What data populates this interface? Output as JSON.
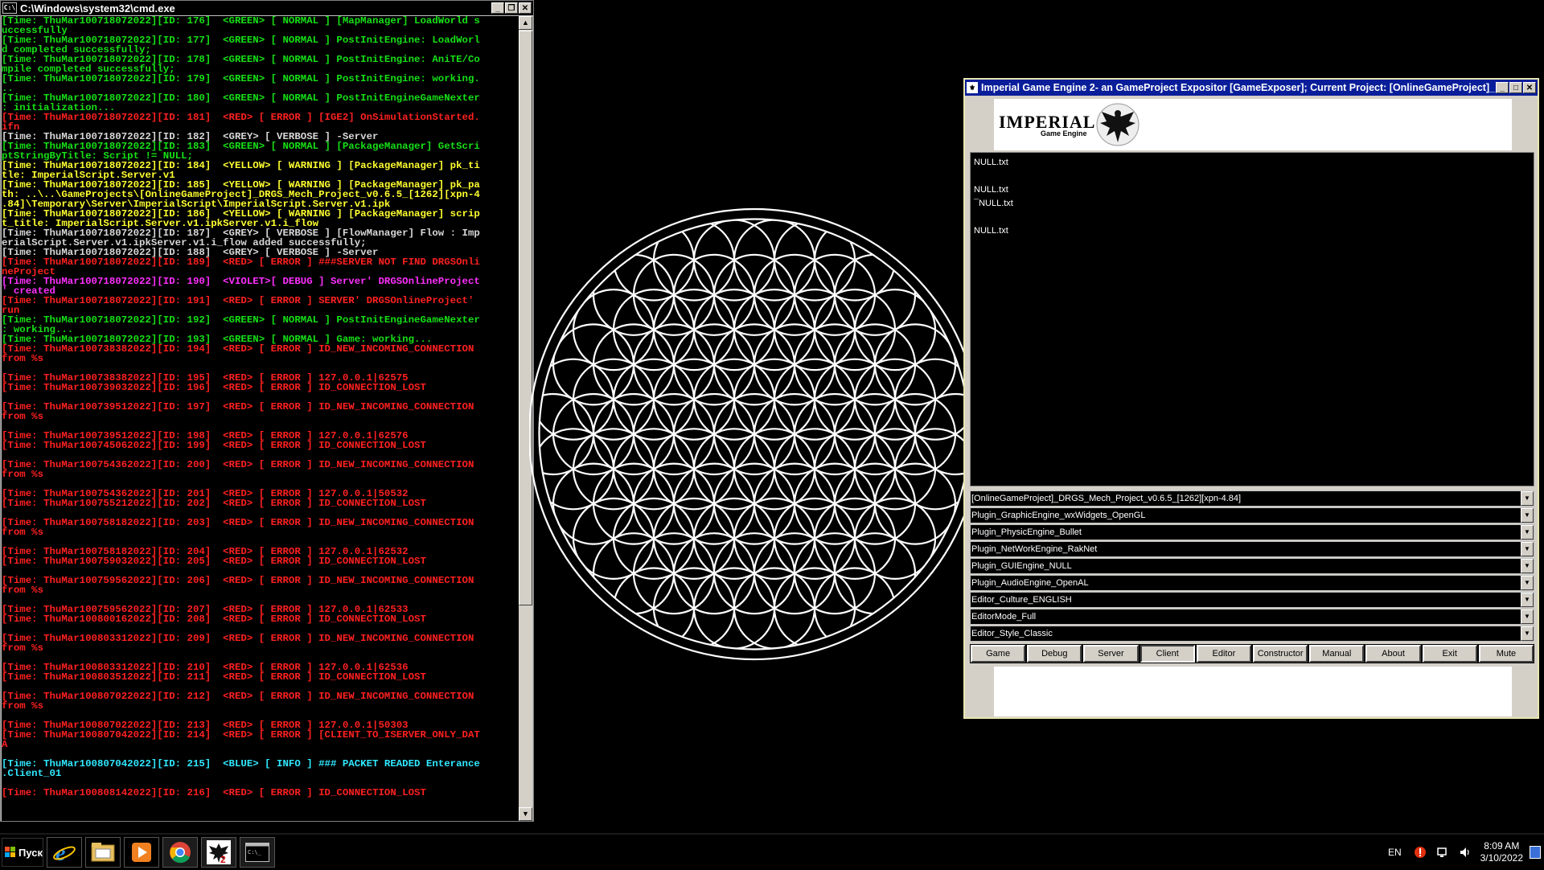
{
  "cmd": {
    "title": "C:\\Windows\\system32\\cmd.exe",
    "lines": [
      {
        "t": "[Time: ThuMar100718072022][ID: 176]  <GREEN> [ NORMAL ] [MapManager] LoadWorld s",
        "c": "green"
      },
      {
        "t": "uccessfully",
        "c": "green"
      },
      {
        "t": "[Time: ThuMar100718072022][ID: 177]  <GREEN> [ NORMAL ] PostInitEngine: LoadWorl",
        "c": "green"
      },
      {
        "t": "d completed successfully;",
        "c": "green"
      },
      {
        "t": "[Time: ThuMar100718072022][ID: 178]  <GREEN> [ NORMAL ] PostInitEngine: AniTE/Co",
        "c": "green"
      },
      {
        "t": "mpile completed successfully;",
        "c": "green"
      },
      {
        "t": "[Time: ThuMar100718072022][ID: 179]  <GREEN> [ NORMAL ] PostInitEngine: working.",
        "c": "green"
      },
      {
        "t": "..",
        "c": "green"
      },
      {
        "t": "[Time: ThuMar100718072022][ID: 180]  <GREEN> [ NORMAL ] PostInitEngineGameNexter",
        "c": "green"
      },
      {
        "t": ": initialization...",
        "c": "green"
      },
      {
        "t": "[Time: ThuMar100718072022][ID: 181]  <RED> [ ERROR ] [IGE2] OnSimulationStarted.",
        "c": "red"
      },
      {
        "t": "ifn",
        "c": "red"
      },
      {
        "t": "[Time: ThuMar100718072022][ID: 182]  <GREY> [ VERBOSE ] -Server",
        "c": "grey"
      },
      {
        "t": "[Time: ThuMar100718072022][ID: 183]  <GREEN> [ NORMAL ] [PackageManager] GetScri",
        "c": "green"
      },
      {
        "t": "ptStringByTitle: Script != NULL;",
        "c": "green"
      },
      {
        "t": "[Time: ThuMar100718072022][ID: 184]  <YELLOW> [ WARNING ] [PackageManager] pk_ti",
        "c": "yellow"
      },
      {
        "t": "tle: ImperialScript.Server.v1",
        "c": "yellow"
      },
      {
        "t": "[Time: ThuMar100718072022][ID: 185]  <YELLOW> [ WARNING ] [PackageManager] pk_pa",
        "c": "yellow"
      },
      {
        "t": "th: ..\\..\\GameProjects\\[OnlineGameProject]_DRGS_Mech_Project_v0.6.5_[1262][xpn-4",
        "c": "yellow"
      },
      {
        "t": ".84]\\Temporary\\Server\\ImperialScript\\ImperialScript.Server.v1.ipk",
        "c": "yellow"
      },
      {
        "t": "[Time: ThuMar100718072022][ID: 186]  <YELLOW> [ WARNING ] [PackageManager] scrip",
        "c": "yellow"
      },
      {
        "t": "t_title: ImperialScript.Server.v1.ipkServer.v1.i_flow",
        "c": "yellow"
      },
      {
        "t": "[Time: ThuMar100718072022][ID: 187]  <GREY> [ VERBOSE ] [FlowManager] Flow : Imp",
        "c": "grey"
      },
      {
        "t": "erialScript.Server.v1.ipkServer.v1.i_flow added successfully;",
        "c": "grey"
      },
      {
        "t": "[Time: ThuMar100718072022][ID: 188]  <GREY> [ VERBOSE ] -Server",
        "c": "grey"
      },
      {
        "t": "[Time: ThuMar100718072022][ID: 189]  <RED> [ ERROR ] ###SERVER NOT FIND DRGSOnli",
        "c": "red"
      },
      {
        "t": "neProject",
        "c": "red"
      },
      {
        "t": "[Time: ThuMar100718072022][ID: 190]  <VIOLET>[ DEBUG ] Server' DRGSOnlineProject",
        "c": "violet"
      },
      {
        "t": "' created",
        "c": "violet"
      },
      {
        "t": "[Time: ThuMar100718072022][ID: 191]  <RED> [ ERROR ] SERVER' DRGSOnlineProject'",
        "c": "red"
      },
      {
        "t": "run",
        "c": "red"
      },
      {
        "t": "[Time: ThuMar100718072022][ID: 192]  <GREEN> [ NORMAL ] PostInitEngineGameNexter",
        "c": "green"
      },
      {
        "t": ": working...",
        "c": "green"
      },
      {
        "t": "[Time: ThuMar100718072022][ID: 193]  <GREEN> [ NORMAL ] Game: working...",
        "c": "green"
      },
      {
        "t": "[Time: ThuMar100738382022][ID: 194]  <RED> [ ERROR ] ID_NEW_INCOMING_CONNECTION",
        "c": "red"
      },
      {
        "t": "from %s",
        "c": "red"
      },
      {
        "t": "",
        "c": "red"
      },
      {
        "t": "[Time: ThuMar100738382022][ID: 195]  <RED> [ ERROR ] 127.0.0.1|62575",
        "c": "red"
      },
      {
        "t": "[Time: ThuMar100739032022][ID: 196]  <RED> [ ERROR ] ID_CONNECTION_LOST",
        "c": "red"
      },
      {
        "t": "",
        "c": "red"
      },
      {
        "t": "[Time: ThuMar100739512022][ID: 197]  <RED> [ ERROR ] ID_NEW_INCOMING_CONNECTION",
        "c": "red"
      },
      {
        "t": "from %s",
        "c": "red"
      },
      {
        "t": "",
        "c": "red"
      },
      {
        "t": "[Time: ThuMar100739512022][ID: 198]  <RED> [ ERROR ] 127.0.0.1|62576",
        "c": "red"
      },
      {
        "t": "[Time: ThuMar100745062022][ID: 199]  <RED> [ ERROR ] ID_CONNECTION_LOST",
        "c": "red"
      },
      {
        "t": "",
        "c": "red"
      },
      {
        "t": "[Time: ThuMar100754362022][ID: 200]  <RED> [ ERROR ] ID_NEW_INCOMING_CONNECTION",
        "c": "red"
      },
      {
        "t": "from %s",
        "c": "red"
      },
      {
        "t": "",
        "c": "red"
      },
      {
        "t": "[Time: ThuMar100754362022][ID: 201]  <RED> [ ERROR ] 127.0.0.1|50532",
        "c": "red"
      },
      {
        "t": "[Time: ThuMar100755212022][ID: 202]  <RED> [ ERROR ] ID_CONNECTION_LOST",
        "c": "red"
      },
      {
        "t": "",
        "c": "red"
      },
      {
        "t": "[Time: ThuMar100758182022][ID: 203]  <RED> [ ERROR ] ID_NEW_INCOMING_CONNECTION",
        "c": "red"
      },
      {
        "t": "from %s",
        "c": "red"
      },
      {
        "t": "",
        "c": "red"
      },
      {
        "t": "[Time: ThuMar100758182022][ID: 204]  <RED> [ ERROR ] 127.0.0.1|62532",
        "c": "red"
      },
      {
        "t": "[Time: ThuMar100759032022][ID: 205]  <RED> [ ERROR ] ID_CONNECTION_LOST",
        "c": "red"
      },
      {
        "t": "",
        "c": "red"
      },
      {
        "t": "[Time: ThuMar100759562022][ID: 206]  <RED> [ ERROR ] ID_NEW_INCOMING_CONNECTION",
        "c": "red"
      },
      {
        "t": "from %s",
        "c": "red"
      },
      {
        "t": "",
        "c": "red"
      },
      {
        "t": "[Time: ThuMar100759562022][ID: 207]  <RED> [ ERROR ] 127.0.0.1|62533",
        "c": "red"
      },
      {
        "t": "[Time: ThuMar100800162022][ID: 208]  <RED> [ ERROR ] ID_CONNECTION_LOST",
        "c": "red"
      },
      {
        "t": "",
        "c": "red"
      },
      {
        "t": "[Time: ThuMar100803312022][ID: 209]  <RED> [ ERROR ] ID_NEW_INCOMING_CONNECTION",
        "c": "red"
      },
      {
        "t": "from %s",
        "c": "red"
      },
      {
        "t": "",
        "c": "red"
      },
      {
        "t": "[Time: ThuMar100803312022][ID: 210]  <RED> [ ERROR ] 127.0.0.1|62536",
        "c": "red"
      },
      {
        "t": "[Time: ThuMar100803512022][ID: 211]  <RED> [ ERROR ] ID_CONNECTION_LOST",
        "c": "red"
      },
      {
        "t": "",
        "c": "red"
      },
      {
        "t": "[Time: ThuMar100807022022][ID: 212]  <RED> [ ERROR ] ID_NEW_INCOMING_CONNECTION",
        "c": "red"
      },
      {
        "t": "from %s",
        "c": "red"
      },
      {
        "t": "",
        "c": "red"
      },
      {
        "t": "[Time: ThuMar100807022022][ID: 213]  <RED> [ ERROR ] 127.0.0.1|50303",
        "c": "red"
      },
      {
        "t": "[Time: ThuMar100807042022][ID: 214]  <RED> [ ERROR ] [CLIENT_TO_ISERVER_ONLY_DAT",
        "c": "red"
      },
      {
        "t": "A",
        "c": "red"
      },
      {
        "t": "",
        "c": "red"
      },
      {
        "t": "[Time: ThuMar100807042022][ID: 215]  <BLUE> [ INFO ] ### PACKET READED Enterance",
        "c": "blue"
      },
      {
        "t": ".Client_01",
        "c": "blue"
      },
      {
        "t": "",
        "c": "red"
      },
      {
        "t": "[Time: ThuMar100808142022][ID: 216]  <RED> [ ERROR ] ID_CONNECTION_LOST",
        "c": "red"
      }
    ]
  },
  "engine": {
    "title": "Imperial Game Engine 2- an GameProject Expositor [GameExposer];   Current Project: [OnlineGameProject]_...",
    "logo_text": "IMPERIAL",
    "logo_sub": "Game Engine",
    "files": [
      "NULL.txt",
      "",
      "NULL.txt",
      "¯NULL.txt",
      "",
      "NULL.txt"
    ],
    "combos": [
      "[OnlineGameProject]_DRGS_Mech_Project_v0.6.5_[1262][xpn-4.84]",
      "Plugin_GraphicEngine_wxWidgets_OpenGL",
      "Plugin_PhysicEngine_Bullet",
      "Plugin_NetWorkEngine_RakNet",
      "Plugin_GUIEngine_NULL",
      "Plugin_AudioEngine_OpenAL",
      "Editor_Culture_ENGLISH",
      "EditorMode_Full",
      "Editor_Style_Classic"
    ],
    "buttons": [
      "Game",
      "Debug",
      "Server",
      "Client",
      "Editor",
      "Constructor",
      "Manual",
      "About",
      "Exit",
      "Mute"
    ],
    "active_button": "Client"
  },
  "taskbar": {
    "start_label": "Пуск",
    "apps": [
      "ie-icon",
      "explorer-icon",
      "media-player-icon",
      "chrome-icon",
      "imperial-engine-icon",
      "cmd-icon"
    ],
    "lang": "EN",
    "time": "8:09 AM",
    "date": "3/10/2022"
  },
  "colors": {
    "green": "#16e016",
    "red": "#ff2020",
    "grey": "#d8d8d8",
    "yellow": "#ffff30",
    "violet": "#ff30ff",
    "blue": "#30e8ff",
    "engine_title": "#0a1e9a"
  }
}
